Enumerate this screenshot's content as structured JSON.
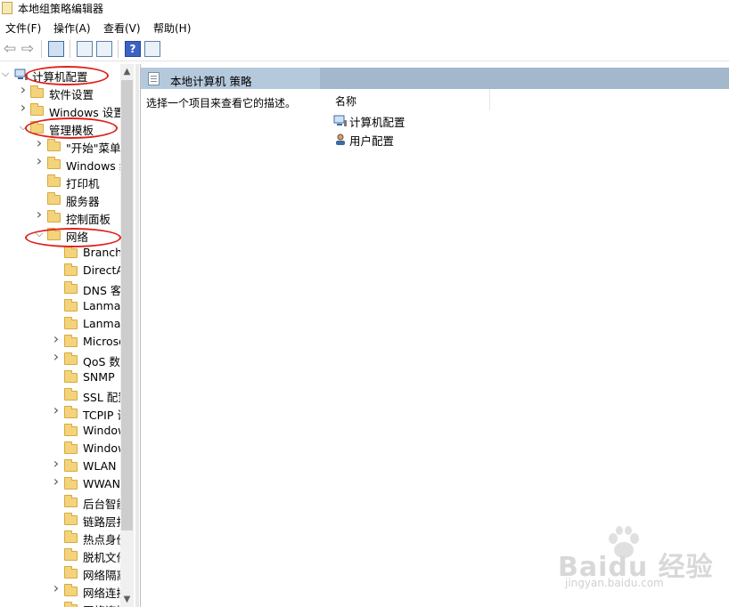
{
  "window": {
    "title": "本地组策略编辑器"
  },
  "menu": [
    "文件(F)",
    "操作(A)",
    "查看(V)",
    "帮助(H)"
  ],
  "toolbar": {
    "back_icon": "back-arrow-icon",
    "forward_icon": "forward-arrow-icon",
    "help_label": "?"
  },
  "tree": {
    "root": {
      "label": "计算机配置",
      "expanded": true
    },
    "items": [
      {
        "label": "软件设置",
        "expandable": true
      },
      {
        "label": "Windows 设置",
        "expandable": true
      },
      {
        "label": "管理模板",
        "expandable": true,
        "expanded": true
      },
      {
        "label": "\"开始\"菜单",
        "expandable": true
      },
      {
        "label": "Windows 组件",
        "expandable": true
      },
      {
        "label": "打印机",
        "expandable": false
      },
      {
        "label": "服务器",
        "expandable": false
      },
      {
        "label": "控制面板",
        "expandable": true
      },
      {
        "label": "网络",
        "expandable": true,
        "expanded": true
      },
      {
        "label": "BranchCache",
        "expandable": false
      },
      {
        "label": "DirectAccess",
        "expandable": false
      },
      {
        "label": "DNS 客户端",
        "expandable": false
      },
      {
        "label": "Lanman",
        "expandable": false
      },
      {
        "label": "Lanman",
        "expandable": false
      },
      {
        "label": "Microsoft",
        "expandable": true
      },
      {
        "label": "QoS 数据包",
        "expandable": true
      },
      {
        "label": "SNMP",
        "expandable": false
      },
      {
        "label": "SSL 配置",
        "expandable": false
      },
      {
        "label": "TCPIP 设置",
        "expandable": true
      },
      {
        "label": "Windows",
        "expandable": false
      },
      {
        "label": "Windows",
        "expandable": false
      },
      {
        "label": "WLAN",
        "expandable": true
      },
      {
        "label": "WWAN",
        "expandable": true
      },
      {
        "label": "后台智能",
        "expandable": false
      },
      {
        "label": "链路层拓扑",
        "expandable": false
      },
      {
        "label": "热点身份",
        "expandable": false
      },
      {
        "label": "脱机文件",
        "expandable": false
      },
      {
        "label": "网络隔离",
        "expandable": false
      },
      {
        "label": "网络连接",
        "expandable": true
      },
      {
        "label": "网络连接",
        "expandable": false
      }
    ]
  },
  "details": {
    "header_title": "本地计算机 策略",
    "description": "选择一个项目来查看它的描述。",
    "column_name": "名称",
    "items": [
      {
        "label": "计算机配置"
      },
      {
        "label": "用户配置"
      }
    ]
  },
  "annotations": {
    "highlight_color": "#e0201a"
  },
  "watermark": {
    "text": "Baidu 经验",
    "url": "jingyan.baidu.com"
  },
  "colors": {
    "header_band": "#b5c9dd",
    "folder": "#f4d37d"
  }
}
